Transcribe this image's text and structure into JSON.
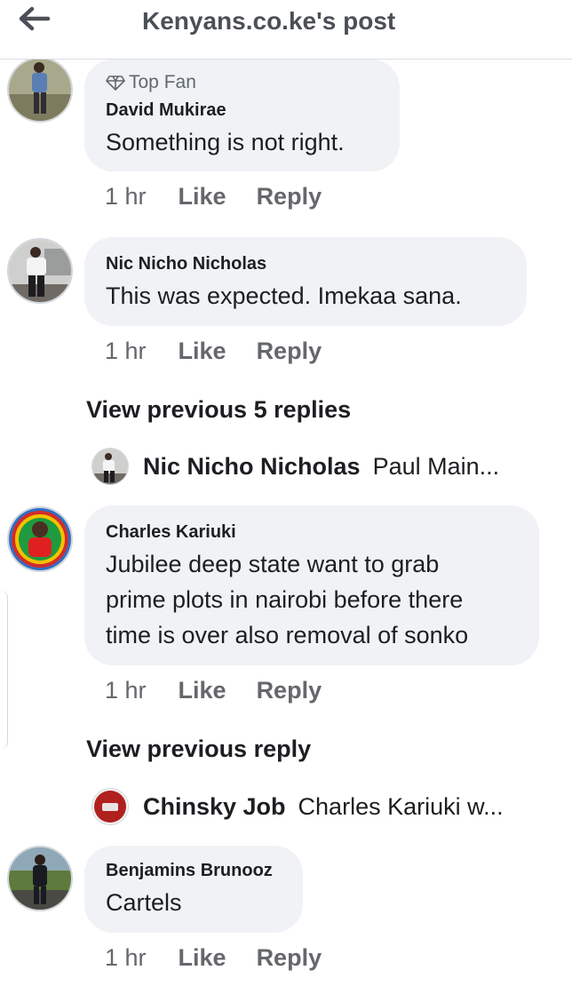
{
  "header": {
    "title": "Kenyans.co.ke's post",
    "back_icon": "arrow-left-icon"
  },
  "comments": [
    {
      "badge": "Top Fan",
      "badge_icon": "diamond-icon",
      "author": "David Mukirae",
      "text": "Something is not right.",
      "time": "1 hr",
      "like": "Like",
      "reply": "Reply"
    },
    {
      "author": "Nic Nicho Nicholas",
      "text": "This was expected. Imekaa sana.",
      "time": "1 hr",
      "like": "Like",
      "reply": "Reply",
      "view_replies": "View previous 5 replies",
      "reply_preview": {
        "author": "Nic Nicho Nicholas",
        "text": "Paul Main..."
      }
    },
    {
      "author": "Charles Kariuki",
      "text_lines": [
        "Jubilee deep state want to grab",
        "prime plots in nairobi before there",
        "time is over also removal of sonko"
      ],
      "time": "1 hr",
      "like": "Like",
      "reply": "Reply",
      "view_replies": "View previous reply",
      "reply_preview": {
        "author": "Chinsky Job",
        "text": "Charles Kariuki w..."
      }
    },
    {
      "author": "Benjamins Brunooz",
      "text": "Cartels",
      "time": "1 hr",
      "like": "Like",
      "reply": "Reply"
    }
  ]
}
